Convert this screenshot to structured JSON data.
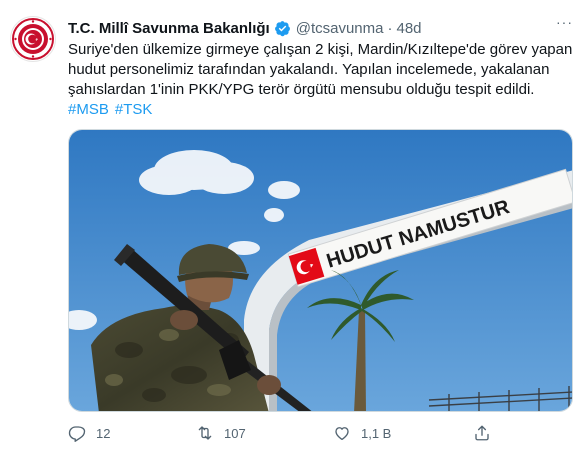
{
  "tweet": {
    "author_name": "T.C. Millî Savunma Bakanlığı",
    "handle": "@tcsavunma",
    "separator": "·",
    "time": "48d",
    "more_label": "···",
    "text": "Suriye'den ülkemize girmeye çalışan 2 kişi, Mardin/Kızıltepe'de görev yapan hudut personelimiz tarafından yakalandı. Yapılan incelemede, yakalanan şahıslardan 1'inin PKK/YPG terör örgütü mensubu olduğu tespit edildi.",
    "hashtags": [
      "#MSB",
      "#TSK"
    ]
  },
  "media": {
    "gate_sign_text": "HUDUT NAMUSTUR"
  },
  "actions": {
    "reply_count": "12",
    "retweet_count": "107",
    "like_count": "1,1 B"
  },
  "icons": {
    "verified": "verified-badge-icon",
    "reply": "reply-icon",
    "retweet": "retweet-icon",
    "like": "heart-icon",
    "share": "share-icon"
  },
  "colors": {
    "link": "#1d9bf0",
    "muted": "#536471",
    "text": "#0f1419",
    "flag_red": "#e30a17"
  }
}
